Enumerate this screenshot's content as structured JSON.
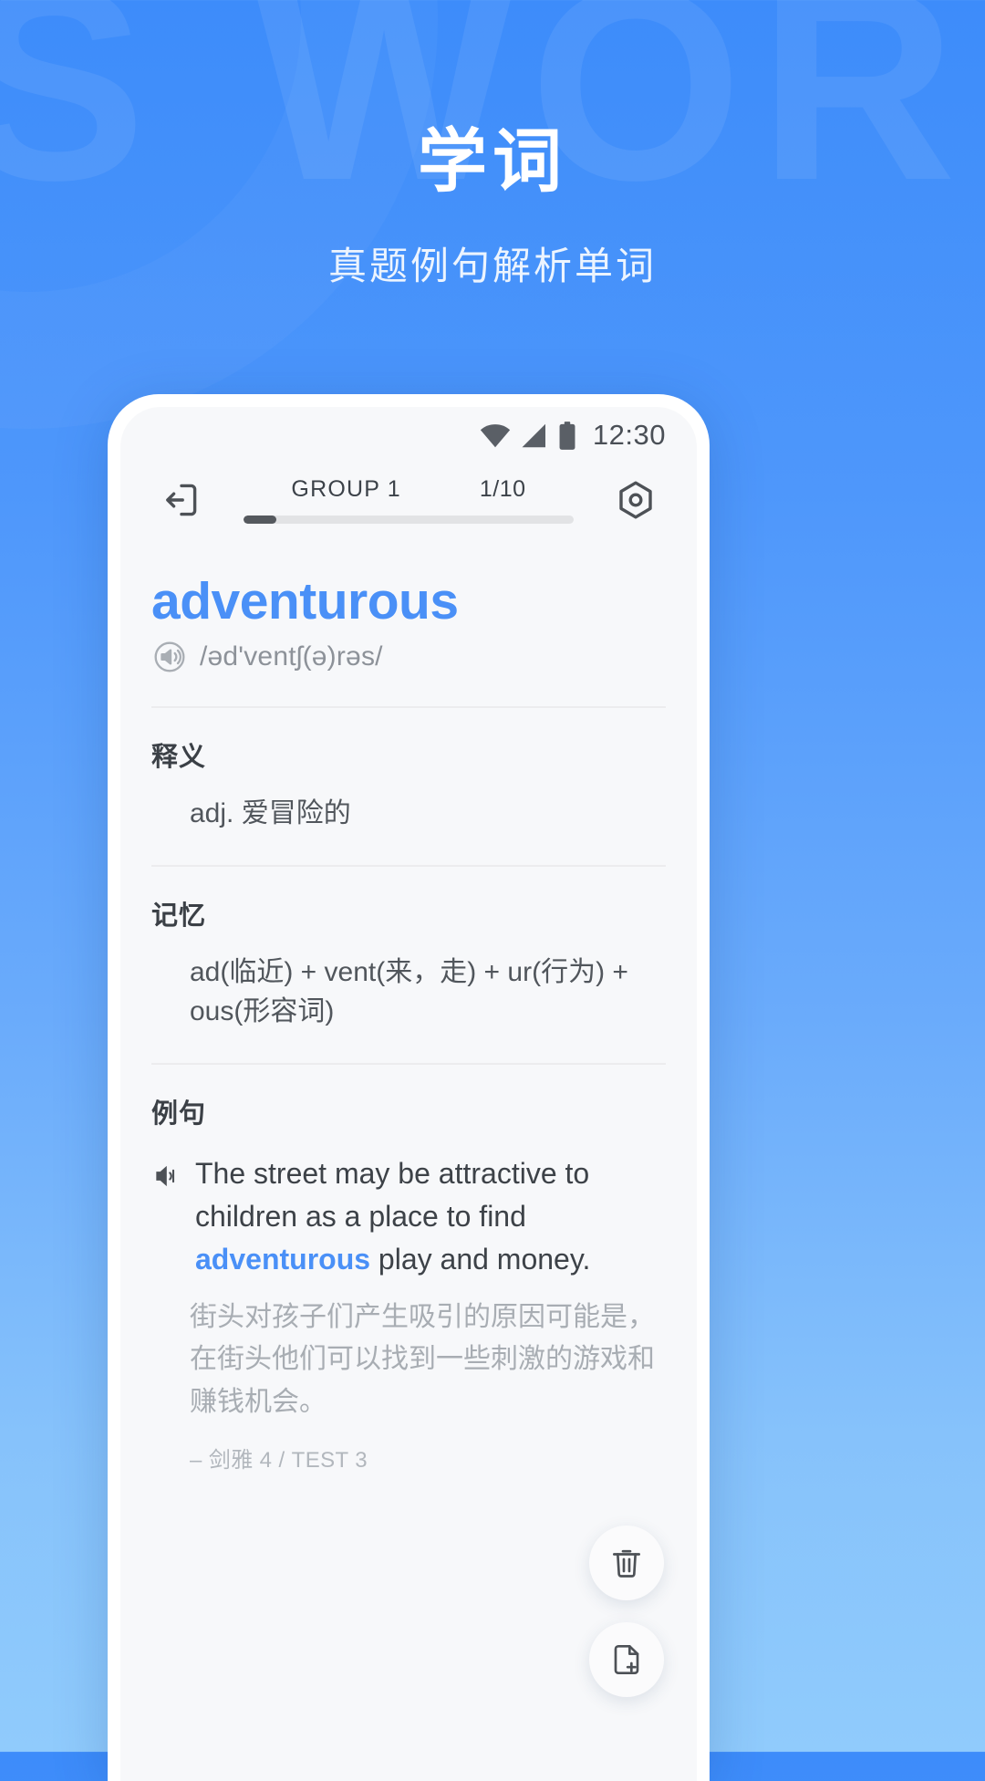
{
  "background": {
    "watermark_text": "S WOR",
    "gradient_top": "#3d8cfa",
    "gradient_bottom": "#90cbfc"
  },
  "hero": {
    "title": "学词",
    "subtitle": "真题例句解析单词"
  },
  "phone": {
    "status_bar": {
      "time": "12:30",
      "icons": [
        "wifi-icon",
        "cellular-signal-icon",
        "battery-icon"
      ]
    },
    "app_bar": {
      "exit_icon": "exit-icon",
      "group_label": "GROUP 1",
      "count_label": "1/10",
      "progress_percent": 10,
      "settings_icon": "hexagon-settings-icon"
    },
    "word_card": {
      "word": "adventurous",
      "speaker_icon": "speaker-circle-icon",
      "phonetic": "/əd'ventʃ(ə)rəs/",
      "sections": {
        "definition": {
          "title": "释义",
          "body": "adj. 爱冒险的"
        },
        "mnemonic": {
          "title": "记忆",
          "body": "ad(临近) + vent(来，走) + ur(行为) + ous(形容词)"
        },
        "example": {
          "title": "例句",
          "speaker_icon": "speaker-icon",
          "en_before": "The street may be attractive to children as a place to find ",
          "en_highlight": "adventurous",
          "en_after": " play and money.",
          "cn": "街头对孩子们产生吸引的原因可能是，在街头他们可以找到一些刺激的游戏和赚钱机会。",
          "source": "– 剑雅 4 / TEST 3"
        }
      }
    },
    "fabs": [
      {
        "name": "delete-fab",
        "icon": "trash-icon"
      },
      {
        "name": "add-note-fab",
        "icon": "document-add-icon"
      }
    ]
  },
  "colors": {
    "accent": "#4a90f7",
    "screen_bg": "#f7f8fa",
    "text_primary": "#3b4046",
    "text_muted": "#a8adb3"
  }
}
